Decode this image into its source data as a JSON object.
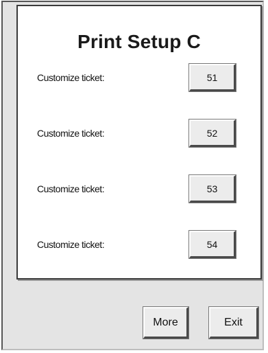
{
  "panel": {
    "title": "Print Setup C"
  },
  "rows": [
    {
      "label": "Customize ticket:",
      "button": "51"
    },
    {
      "label": "Customize ticket:",
      "button": "52"
    },
    {
      "label": "Customize ticket:",
      "button": "53"
    },
    {
      "label": "Customize ticket:",
      "button": "54"
    }
  ],
  "footer": {
    "more_label": "More",
    "exit_label": "Exit"
  }
}
